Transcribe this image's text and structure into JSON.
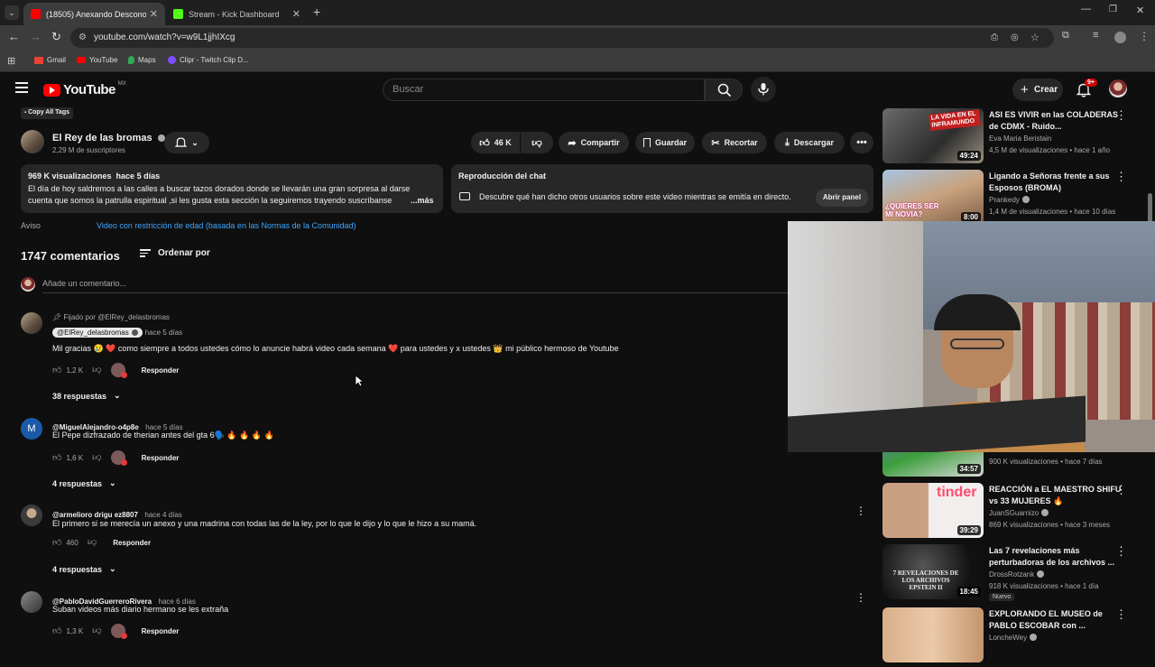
{
  "browser": {
    "tabs": [
      {
        "title": "(18505) Anexando Desconocid",
        "active": true
      },
      {
        "title": "Stream - Kick Dashboard",
        "active": false
      }
    ],
    "url": "youtube.com/watch?v=w9L1jjhIXcg",
    "bookmarks": [
      "Gmail",
      "YouTube",
      "Maps",
      "Clipr - Twitch Clip D..."
    ]
  },
  "header": {
    "logo": "YouTube",
    "region": "MX",
    "search_placeholder": "Buscar",
    "create_label": "Crear",
    "notif_badge": "9+"
  },
  "video": {
    "copy_tags_label": "Copy All Tags",
    "channel_name": "El Rey de las bromas",
    "subscribers": "2,29 M de suscriptores",
    "likes": "46 K",
    "actions": [
      "Compartir",
      "Guardar",
      "Recortar",
      "Descargar"
    ],
    "views_date": "969 K visualizaciones  hace 5 días",
    "description_line1": "El día de hoy saldremos a las calles a buscar tazos dorados donde se llevarán una gran sorpresa al darse",
    "description_line2": "cuenta que somos la patrulla espiritual ,si les gusta esta sección la seguiremos trayendo suscríbanse",
    "more_label": "...más",
    "chat_title": "Reproducción del chat",
    "chat_desc": "Descubre qué han dicho otros usuarios sobre este video mientras se emitía en directo.",
    "chat_button": "Abrir panel",
    "notice_label": "Aviso",
    "notice_link": "Video con restricción de edad (basada en las Normas de la Comunidad)"
  },
  "comments_section": {
    "count": "1747 comentarios",
    "sort_label": "Ordenar por",
    "add_placeholder": "Añade un comentario...",
    "reply_label": "Responder",
    "comments": [
      {
        "pinned": "Fijado por @ElRey_delasbromas",
        "handle": "@ElRey_delasbromas",
        "when": "hace 5 días",
        "text": "Mil gracias 😢 ❤️ como siempre a todos ustedes cómo lo anuncie habrá video cada semana ❤️ para ustedes y x ustedes 👑 mi público hermoso de Youtube",
        "likes": "1,2 K",
        "replies": "38 respuestas"
      },
      {
        "handle": "@MiguelAlejandro-o4p8e",
        "when": "hace 5 días",
        "text": "El Pepe dizfrazado de therian antes del gta 6🗣️ 🔥 🔥 🔥 🔥",
        "likes": "1,6 K",
        "replies": "4 respuestas",
        "avatar_letter": "M"
      },
      {
        "handle": "@armelioro drigu ez8807",
        "when": "hace 4 días",
        "text": "El primero si se merecía un anexo y una madrina con todas las de la ley, por lo que le dijo y lo que le hizo a su mamá.",
        "likes": "460",
        "replies": "4 respuestas"
      },
      {
        "handle": "@PabloDavidGuerreroRivera",
        "when": "hace 6 días",
        "text": "Suban videos más diario hermano se les extraña",
        "likes": "1,3 K"
      }
    ]
  },
  "sidebar": {
    "videos": [
      {
        "title": "ASI ES VIVIR en las COLADERAS de CDMX - Ruido...",
        "channel": "Eva Maria Beristain",
        "meta": "4,5 M de visualizaciones • hace 1 año",
        "duration": "49:24",
        "thumb_text": "LA VIDA EN EL INFRAMUNDO"
      },
      {
        "title": "Ligando a Señoras frente a sus Esposos (BROMA)",
        "channel": "Prankedy",
        "meta": "1,4 M de visualizaciones • hace 10 días",
        "duration": "8:00",
        "thumb_text": "¿QUIERES SER MI NOVIA?"
      },
      {
        "title": "",
        "channel": "",
        "meta": "900 K visualizaciones • hace 7 días",
        "duration": "34:57"
      },
      {
        "title": "REACCIÓN a EL MAESTRO SHIFU vs 33 MUJERES 🔥",
        "channel": "JuanSGuarnizo",
        "meta": "869 K visualizaciones • hace 3 meses",
        "duration": "39:29",
        "thumb_text": "tinder"
      },
      {
        "title": "Las 7 revelaciones más perturbadoras de los archivos ...",
        "channel": "DrossRotzank",
        "meta": "918 K visualizaciones • hace 1 día",
        "duration": "18:45",
        "badge": "Nuevo",
        "thumb_text": "7 REVELACIONES DE LOS ARCHIVOS EPSTEIN II"
      },
      {
        "title": "EXPLORANDO EL MUSEO de PABLO ESCOBAR con ...",
        "channel": "LoncheWey",
        "meta": "",
        "duration": ""
      }
    ]
  },
  "colors": {
    "bg": "#0f0f0f",
    "chip": "#272727",
    "link": "#3ea6ff",
    "yt_red": "#ff0000"
  }
}
